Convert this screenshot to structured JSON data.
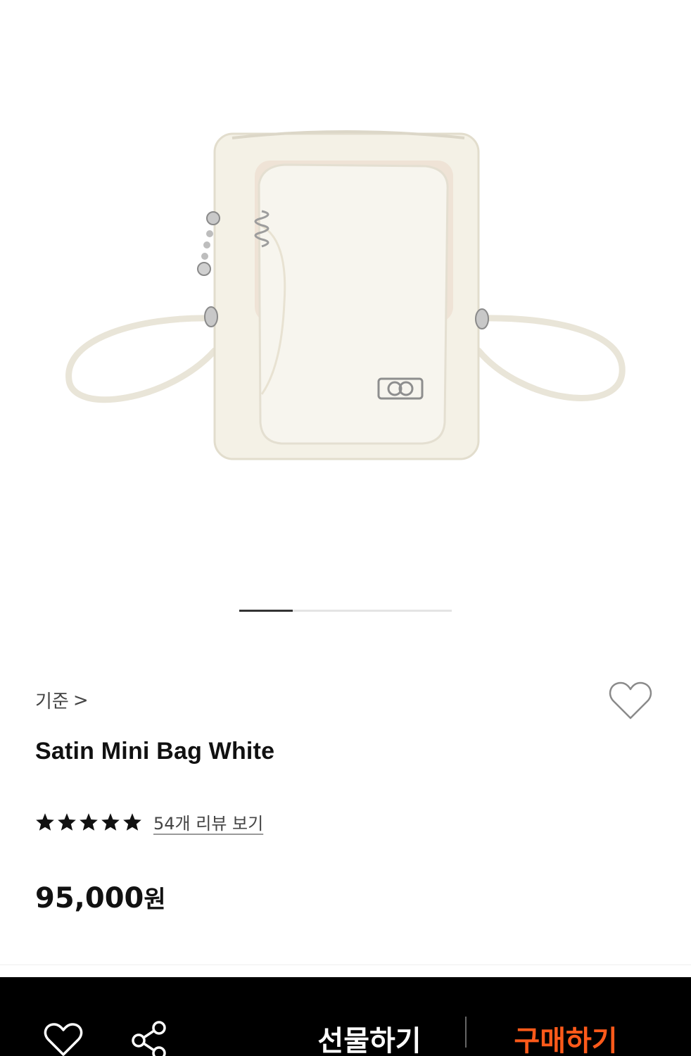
{
  "product": {
    "brand": "기준",
    "brand_chevron": ">",
    "title": "Satin Mini Bag White",
    "rating_stars": 5,
    "review_link": "54개 리뷰 보기",
    "price_amount": "95,000",
    "price_unit": "원",
    "image_alt": "Satin Mini Bag White"
  },
  "gallery": {
    "current_index": 1,
    "progress_fraction": 0.25
  },
  "bottom_bar": {
    "gift_label": "선물하기",
    "buy_label": "구매하기"
  },
  "colors": {
    "accent_buy": "#ff5a1a",
    "bar_background": "#000000",
    "star": "#111111"
  },
  "icons": [
    "heart-outline-icon",
    "share-icon",
    "star-icon",
    "chevron-right-icon"
  ]
}
